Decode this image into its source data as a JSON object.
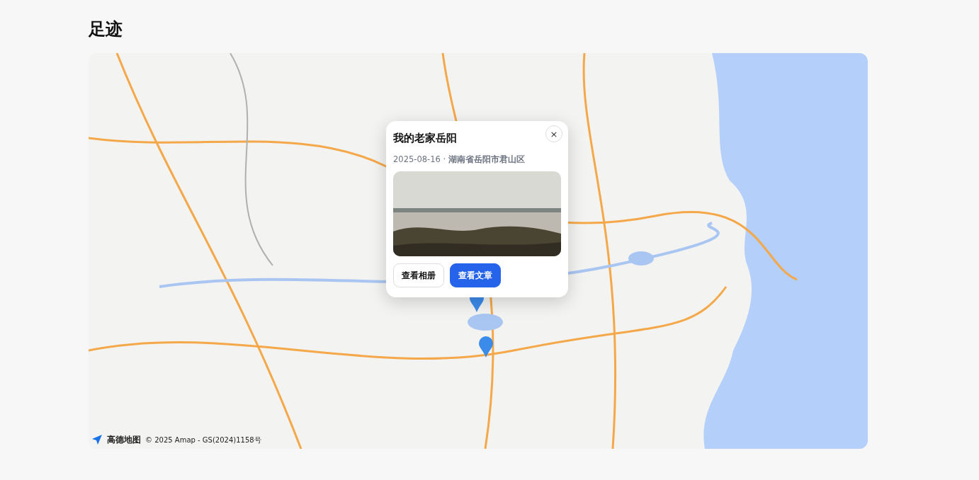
{
  "page": {
    "title": "足迹"
  },
  "map": {
    "kind": "picture",
    "popup": {
      "title": "我的老家岳阳",
      "close": "×",
      "meta": "2025-08-16 · **湖南省岳阳市君山区**",
      "buttons": [
        {
          "label": "查看相册",
          "kind": "secondary"
        },
        {
          "label": "查看文章",
          "kind": "primary"
        }
      ]
    },
    "attribution": {
      "logo": "高德地图",
      "copyright": "© 2025 Amap - GS(2024)1158号"
    }
  }
}
